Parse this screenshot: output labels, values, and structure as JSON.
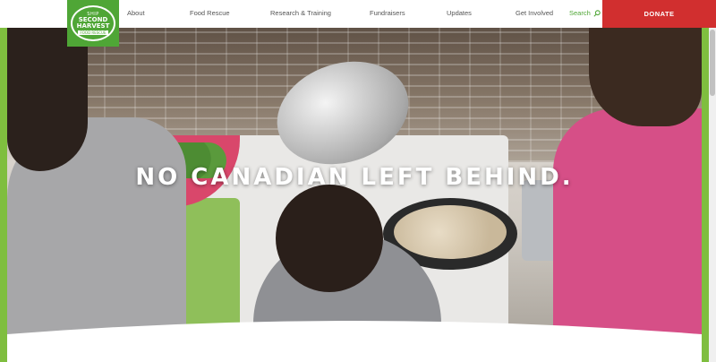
{
  "logo": {
    "top_text": "SHIP",
    "line1": "SECOND",
    "line2": "HARVEST",
    "sub": "FOOD RESCUE",
    "brand_color": "#4fa636"
  },
  "nav": {
    "items": [
      "About",
      "Food Rescue",
      "Research & Training",
      "Fundraisers",
      "Updates",
      "Get Involved"
    ],
    "search_label": "Search",
    "search_icon": "search-icon",
    "donate_label": "DONATE",
    "donate_color": "#d12f2f",
    "text_color": "#555555"
  },
  "hero": {
    "headline": "NO CANADIAN LEFT BEHIND."
  },
  "colors": {
    "side_bar": "#7fbe3f"
  }
}
